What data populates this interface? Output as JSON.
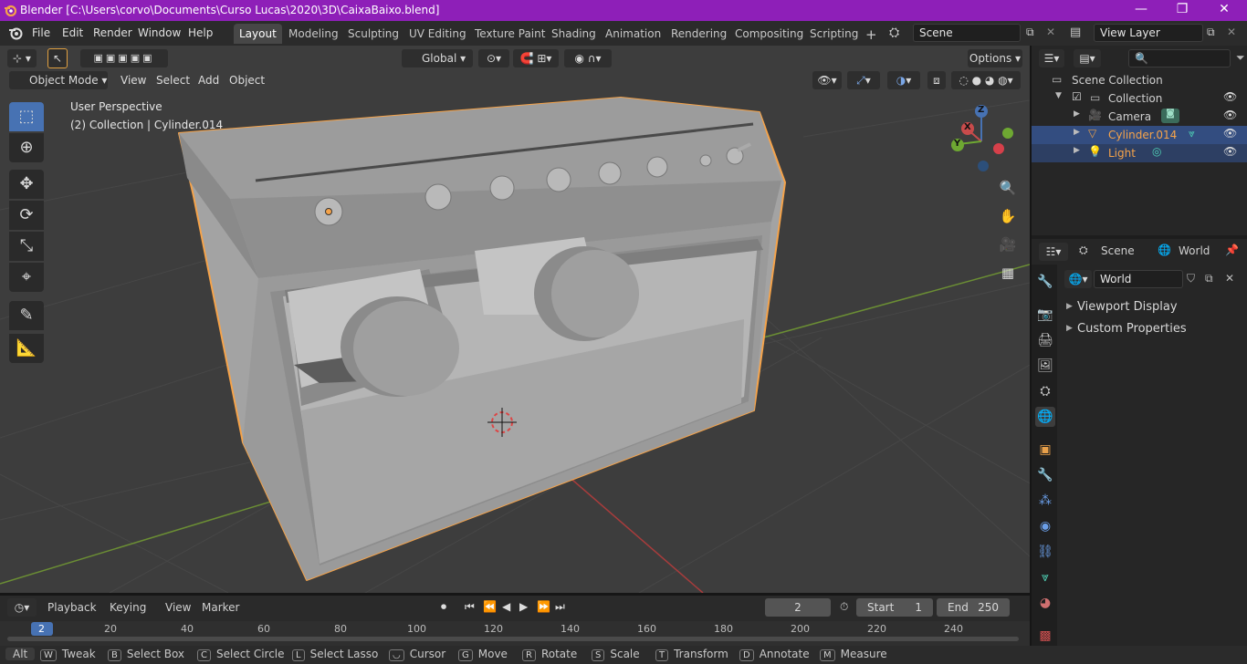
{
  "window": {
    "title": "Blender [C:\\Users\\corvo\\Documents\\Curso Lucas\\2020\\3D\\CaixaBaixo.blend]",
    "minimize_glyph": "—",
    "restore_glyph": "❐",
    "close_glyph": "✕"
  },
  "menu": {
    "items": [
      "File",
      "Edit",
      "Render",
      "Window",
      "Help"
    ]
  },
  "workspaces": {
    "tabs": [
      "Layout",
      "Modeling",
      "Sculpting",
      "UV Editing",
      "Texture Paint",
      "Shading",
      "Animation",
      "Rendering",
      "Compositing",
      "Scripting"
    ],
    "active": "Layout",
    "add_glyph": "+"
  },
  "scene_selector": {
    "value": "Scene"
  },
  "viewlayer_selector": {
    "value": "View Layer"
  },
  "viewport_header": {
    "transform_orientation": "Global",
    "options_label": "Options",
    "mode": "Object Mode",
    "menus": [
      "View",
      "Select",
      "Add",
      "Object"
    ]
  },
  "viewport": {
    "perspective_label": "User Perspective",
    "collection_label": "(2) Collection | Cylinder.014",
    "gizmo": {
      "x": "X",
      "y": "Y",
      "z": "Z"
    }
  },
  "outliner": {
    "search_placeholder": "",
    "rows": [
      {
        "label": "Scene Collection",
        "selected": false,
        "color": "#d0d0d0"
      },
      {
        "label": "Collection",
        "selected": false,
        "color": "#d0d0d0"
      },
      {
        "label": "Camera",
        "selected": false,
        "color": "#d0d0d0"
      },
      {
        "label": "Cylinder.014",
        "selected": true,
        "color": "#f5a34a"
      },
      {
        "label": "Light",
        "selected": true,
        "color": "#f5a34a"
      }
    ]
  },
  "properties": {
    "breadcrumb_scene": "Scene",
    "breadcrumb_world": "World",
    "world_field": "World",
    "sections": [
      "Viewport Display",
      "Custom Properties"
    ]
  },
  "timeline": {
    "menus": [
      "Playback",
      "Keying",
      "View",
      "Marker"
    ],
    "current_frame": "2",
    "start_label": "Start",
    "start_value": "1",
    "end_label": "End",
    "end_value": "250",
    "ruler": [
      "2",
      "20",
      "40",
      "60",
      "80",
      "100",
      "120",
      "140",
      "160",
      "180",
      "200",
      "220",
      "240"
    ]
  },
  "statusbar": {
    "items": [
      {
        "key": "Alt",
        "label": ""
      },
      {
        "key": "W",
        "label": "Tweak"
      },
      {
        "key": "B",
        "label": "Select Box"
      },
      {
        "key": "C",
        "label": "Select Circle"
      },
      {
        "key": "L",
        "label": "Select Lasso"
      },
      {
        "key": "",
        "label": "Cursor"
      },
      {
        "key": "G",
        "label": "Move"
      },
      {
        "key": "R",
        "label": "Rotate"
      },
      {
        "key": "S",
        "label": "Scale"
      },
      {
        "key": "T",
        "label": "Transform"
      },
      {
        "key": "D",
        "label": "Annotate"
      },
      {
        "key": "M",
        "label": "Measure"
      }
    ]
  },
  "colors": {
    "titlebar": "#8e1fb8",
    "selection_outline": "#f5a34a",
    "viewport_bg": "#3d3d3d",
    "accent_blue": "#4772b3"
  }
}
